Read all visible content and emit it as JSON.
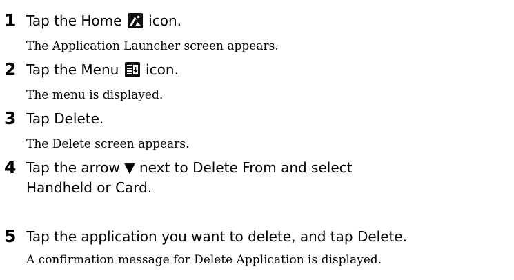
{
  "steps": [
    {
      "number": "1",
      "before": "Tap the Home",
      "icon": "home-icon",
      "after": "icon.",
      "result": "The Application Launcher screen appears."
    },
    {
      "number": "2",
      "before": "Tap the Menu",
      "icon": "menu-icon",
      "after": "icon.",
      "result": "The menu is displayed."
    },
    {
      "number": "3",
      "text": "Tap Delete.",
      "result": "The Delete screen appears."
    },
    {
      "number": "4",
      "line1": "Tap the arrow ▼ next to Delete From and select",
      "line2": "Handheld or Card."
    },
    {
      "number": "5",
      "text": "Tap the application you want to delete, and tap Delete.",
      "result": "A confirmation message for Delete Application is displayed."
    }
  ]
}
